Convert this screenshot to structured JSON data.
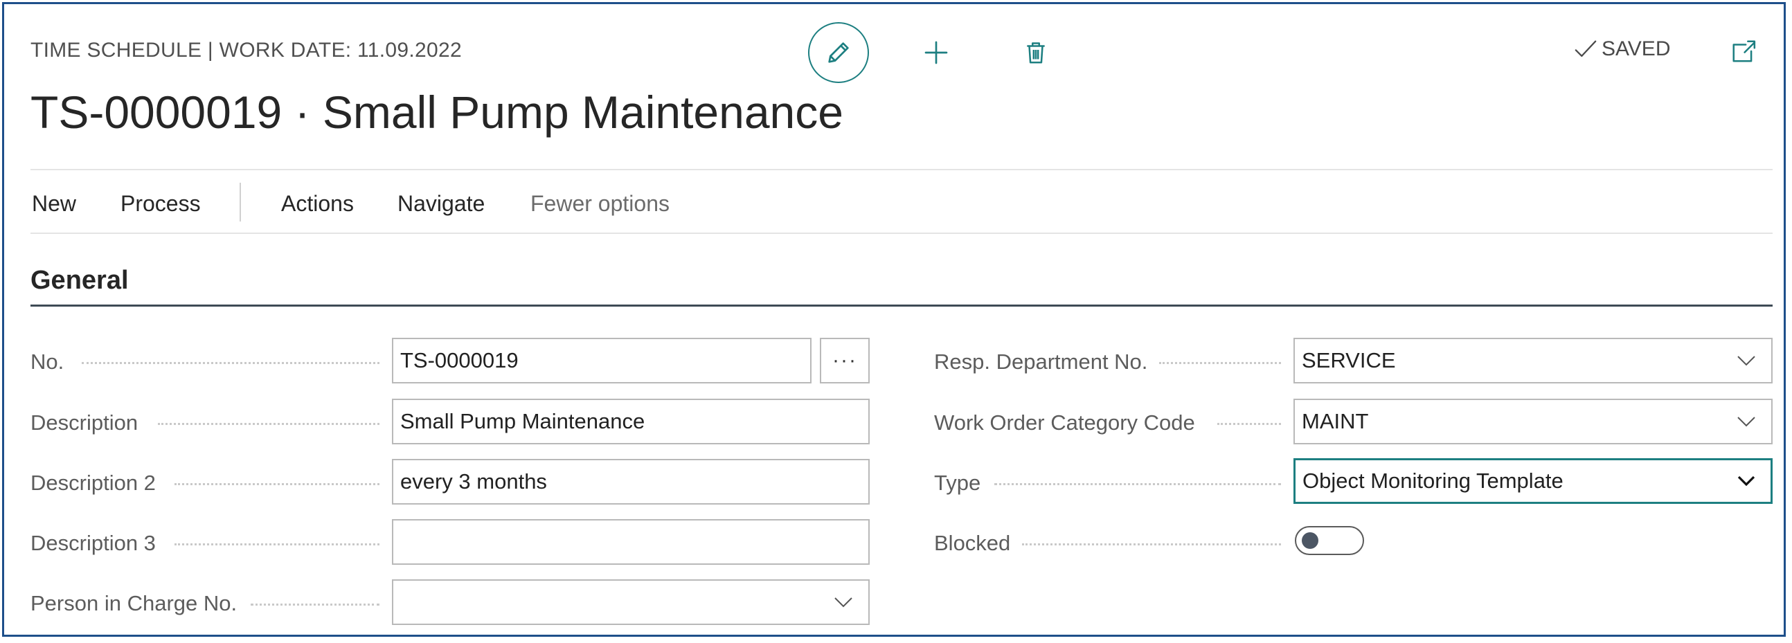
{
  "header": {
    "caption": "TIME SCHEDULE | WORK DATE: 11.09.2022",
    "title": "TS-0000019 · Small Pump Maintenance",
    "saved_label": "SAVED",
    "icons": [
      "pencil-icon",
      "plus-icon",
      "trash-icon",
      "check-icon",
      "open-in-new-icon"
    ]
  },
  "actions": {
    "items": [
      "New",
      "Process",
      "Actions",
      "Navigate",
      "Fewer options"
    ]
  },
  "general": {
    "section_title": "General",
    "left_fields": [
      {
        "label": "No.",
        "value": "TS-0000019"
      },
      {
        "label": "Description",
        "value": "Small Pump Maintenance"
      },
      {
        "label": "Description 2",
        "value": "every 3 months"
      },
      {
        "label": "Description 3",
        "value": ""
      },
      {
        "label": "Person in Charge No.",
        "value": ""
      }
    ],
    "right_fields": [
      {
        "label": "Resp. Department No.",
        "value": "SERVICE"
      },
      {
        "label": "Work Order Category Code",
        "value": "MAINT"
      },
      {
        "label": "Type",
        "value": "Object Monitoring Template"
      },
      {
        "label": "Blocked",
        "value": false
      }
    ],
    "lookup_button_label": "···"
  },
  "colors": {
    "accent": "#1d7f81",
    "frame": "#1e4f8a"
  }
}
